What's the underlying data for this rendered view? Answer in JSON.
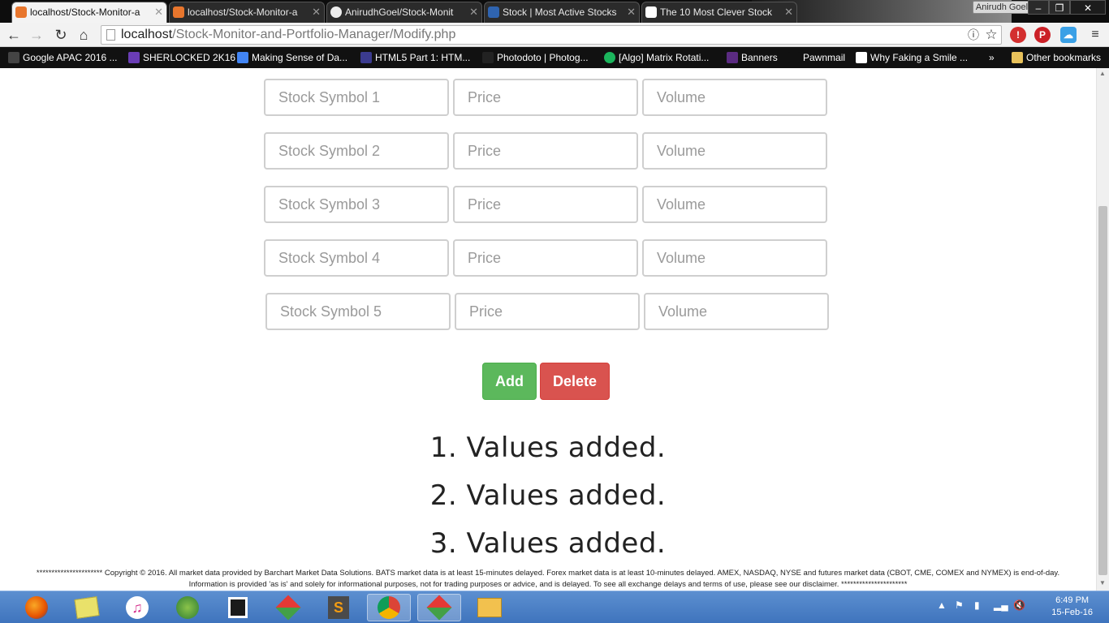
{
  "browser": {
    "tabs": [
      {
        "title": "localhost/Stock-Monitor-a",
        "active": true
      },
      {
        "title": "localhost/Stock-Monitor-a",
        "active": false
      },
      {
        "title": "AnirudhGoel/Stock-Monit",
        "active": false
      },
      {
        "title": "Stock | Most Active Stocks",
        "active": false
      },
      {
        "title": "The 10 Most Clever Stock",
        "active": false
      }
    ],
    "profile_name": "Anirudh Goel",
    "url_host": "localhost",
    "url_path": "/Stock-Monitor-and-Portfolio-Manager/Modify.php"
  },
  "bookmarks": [
    "Google APAC 2016 ...",
    "SHERLOCKED 2K16",
    "Making Sense of Da...",
    "HTML5 Part 1: HTM...",
    "Photodoto | Photog...",
    "[Algo] Matrix Rotati...",
    "Banners",
    "Pawnmail",
    "Why Faking a Smile ...",
    "»",
    "Other bookmarks"
  ],
  "form": {
    "rows": [
      {
        "symbol_placeholder": "Stock Symbol 1",
        "price_placeholder": "Price",
        "volume_placeholder": "Volume"
      },
      {
        "symbol_placeholder": "Stock Symbol 2",
        "price_placeholder": "Price",
        "volume_placeholder": "Volume"
      },
      {
        "symbol_placeholder": "Stock Symbol 3",
        "price_placeholder": "Price",
        "volume_placeholder": "Volume"
      },
      {
        "symbol_placeholder": "Stock Symbol 4",
        "price_placeholder": "Price",
        "volume_placeholder": "Volume"
      },
      {
        "symbol_placeholder": "Stock Symbol 5",
        "price_placeholder": "Price",
        "volume_placeholder": "Volume"
      }
    ],
    "add_label": "Add",
    "delete_label": "Delete"
  },
  "messages": [
    "1. Values added.",
    "2. Values added.",
    "3. Values added."
  ],
  "footer": {
    "line1": "********************** Copyright © 2016. All market data provided by Barchart Market Data Solutions. BATS market data is at least 15-minutes delayed. Forex market data is at least 10-minutes delayed. AMEX, NASDAQ, NYSE and futures market data (CBOT, CME, COMEX and NYMEX) is end-of-day.",
    "line2": "Information is provided 'as is' and solely for informational purposes, not for trading purposes or advice, and is delayed. To see all exchange delays and terms of use, please see our disclaimer. **********************"
  },
  "taskbar": {
    "time": "6:49 PM",
    "date": "15-Feb-16",
    "icons": [
      "firefox-icon",
      "files-icon",
      "itunes-icon",
      "globe-icon",
      "brackets-icon",
      "git-icon",
      "sublime-icon",
      "chrome-icon",
      "git-icon-2",
      "explorer-icon"
    ]
  },
  "colors": {
    "add_button": "#5cb85c",
    "delete_button": "#d9534f",
    "taskbar": "#4a7fc6"
  }
}
